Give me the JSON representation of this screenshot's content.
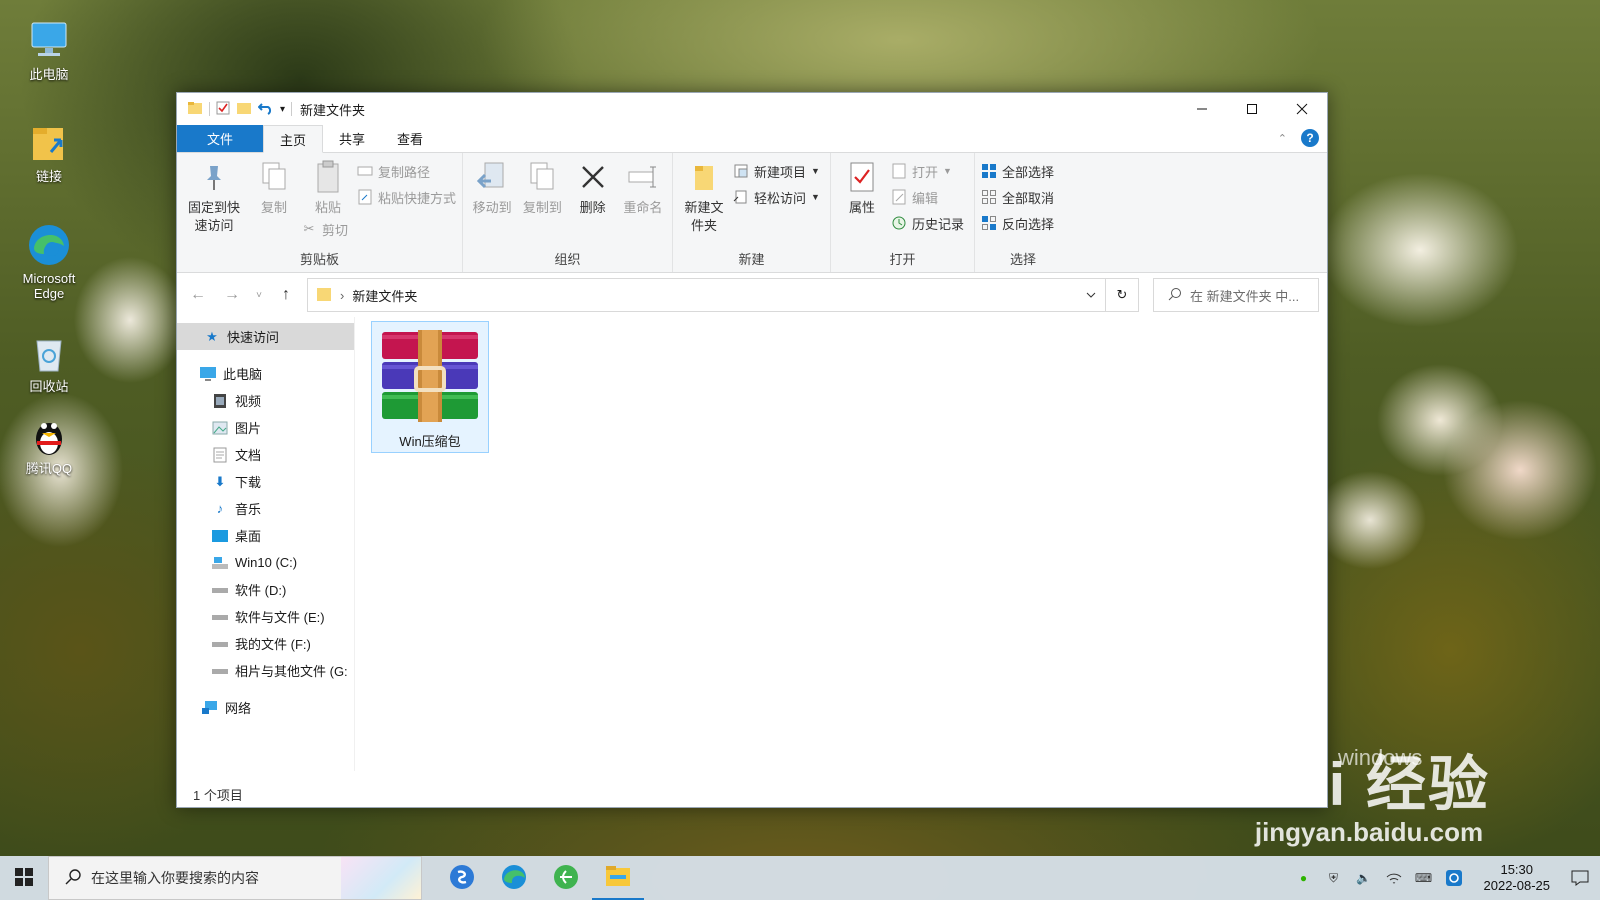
{
  "desktop": {
    "icons": [
      {
        "label": "此电脑"
      },
      {
        "label": "链接"
      },
      {
        "label": "Microsoft Edge"
      },
      {
        "label": "回收站"
      },
      {
        "label": "腾讯QQ"
      }
    ]
  },
  "window": {
    "title": "新建文件夹",
    "tabs": {
      "file": "文件",
      "home": "主页",
      "share": "共享",
      "view": "查看"
    },
    "ribbon": {
      "clipboard": {
        "label": "剪贴板",
        "pin": "固定到快速访问",
        "copy": "复制",
        "paste": "粘贴",
        "copy_path": "复制路径",
        "paste_shortcut": "粘贴快捷方式",
        "cut": "剪切"
      },
      "organize": {
        "label": "组织",
        "move_to": "移动到",
        "copy_to": "复制到",
        "delete": "删除",
        "rename": "重命名"
      },
      "new": {
        "label": "新建",
        "new_folder": "新建文件夹",
        "new_item": "新建项目",
        "easy_access": "轻松访问"
      },
      "open": {
        "label": "打开",
        "properties": "属性",
        "open": "打开",
        "edit": "编辑",
        "history": "历史记录"
      },
      "select": {
        "label": "选择",
        "select_all": "全部选择",
        "select_none": "全部取消",
        "invert": "反向选择"
      }
    },
    "address": {
      "path": "新建文件夹",
      "search_placeholder": "在 新建文件夹 中..."
    },
    "nav": {
      "quick_access": "快速访问",
      "this_pc": "此电脑",
      "items": [
        {
          "label": "视频"
        },
        {
          "label": "图片"
        },
        {
          "label": "文档"
        },
        {
          "label": "下载"
        },
        {
          "label": "音乐"
        },
        {
          "label": "桌面"
        },
        {
          "label": "Win10 (C:)"
        },
        {
          "label": "软件 (D:)"
        },
        {
          "label": "软件与文件 (E:)"
        },
        {
          "label": "我的文件 (F:)"
        },
        {
          "label": "相片与其他文件 (G:"
        }
      ],
      "network": "网络"
    },
    "files": [
      {
        "name": "Win压缩包"
      }
    ],
    "status": "1 个项目"
  },
  "taskbar": {
    "search_placeholder": "在这里输入你要搜索的内容",
    "time": "15:30",
    "date": "2022-08-25"
  },
  "watermark": {
    "logo": "Bai 经验",
    "url": "jingyan.baidu.com",
    "overlay": "windows"
  }
}
